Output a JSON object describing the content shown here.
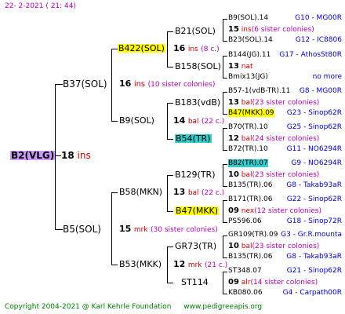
{
  "header": {
    "date": "22-  2-2021",
    "time": "( 21:  44)"
  },
  "footer": {
    "copyright": "Copyright 2004-2021 @ Karl Kehrle Foundation",
    "site": "www.pedigreeapis.org"
  },
  "root": {
    "name": "B2(VLG)",
    "num": "18",
    "note": "ins"
  },
  "gen1": [
    {
      "name": "B37(SOL)",
      "num": "16",
      "note": "ins",
      "sisters": "(10 sister colonies)"
    },
    {
      "name": "B5(SOL)",
      "num": "15",
      "note": "mrk",
      "sisters": "(30 sister colonies)"
    }
  ],
  "gen2": [
    {
      "name": "B422(SOL)",
      "num": "16",
      "note": "ins",
      "sisters": "(8 c.)"
    },
    {
      "name": "B9(SOL)",
      "num": "14",
      "note": "bal",
      "sisters": "(22 c.)"
    },
    {
      "name": "B58(MKN)",
      "num": "13",
      "note": "bal",
      "sisters": "(22 c.)"
    },
    {
      "name": "B53(MKK)",
      "num": "12",
      "note": "mrk",
      "sisters": "(21 c.)"
    }
  ],
  "gen3": [
    {
      "name": "B21(SOL)"
    },
    {
      "name": "B158(SOL)"
    },
    {
      "name": "B183(vdB)"
    },
    {
      "name": "B54(TR)"
    },
    {
      "name": "B129(TR)"
    },
    {
      "name": "B47(MKK)"
    },
    {
      "name": "GR73(TR)"
    },
    {
      "name": "ST114"
    }
  ],
  "gen4": [
    {
      "name": "B9(SOL).14",
      "id": "G10 - MG00R"
    },
    {
      "num": "15",
      "note": "ins",
      "sisters": "(6 sister colonies)"
    },
    {
      "name": "B23(SOL).14",
      "id": "G12 - IC8806"
    },
    {
      "name": "B144(JG).11",
      "id": "G17 - AthosSt80R"
    },
    {
      "num": "13",
      "note": "nat",
      "sisters": ""
    },
    {
      "name": "Bmix13(JG)",
      "id": "no more"
    },
    {
      "name": "B57-1(vdB-TR).11",
      "id": "G8 - MG00R"
    },
    {
      "num": "13",
      "note": "bal",
      "sisters": "(23 sister colonies)"
    },
    {
      "name": "B47(MKK).09",
      "id": "G23 - Sinop62R"
    },
    {
      "name": "B70(TR).10",
      "id": "G25 - Sinop62R"
    },
    {
      "num": "12",
      "note": "bal",
      "sisters": "(24 sister colonies)"
    },
    {
      "name": "B72(TR).10",
      "id": "G11 - NO6294R"
    },
    {
      "name": "B82(TR).07",
      "id": "G9 - NO6294R"
    },
    {
      "num": "10",
      "note": "bal",
      "sisters": "(23 sister colonies)"
    },
    {
      "name": "B135(TR).06",
      "id": "G8 - Takab93aR"
    },
    {
      "name": "B171(TR).06",
      "id": "G22 - Sinop62R"
    },
    {
      "num": "09",
      "note": "nex",
      "sisters": "(12 sister colonies)"
    },
    {
      "name": "PS596.06",
      "id": "G18 - Sinop72R"
    },
    {
      "name": "GR109(TR).09",
      "id": "G3 - Gr.R.mounta"
    },
    {
      "num": "10",
      "note": "bal",
      "sisters": "(23 sister colonies)"
    },
    {
      "name": "B135(TR).06",
      "id": "G8 - Takab93aR"
    },
    {
      "name": "ST348.07",
      "id": "G21 - Sinop62R"
    },
    {
      "num": "09",
      "note": "alr",
      "sisters": "(14 sister colonies)"
    },
    {
      "name": "KB080.06",
      "id": "G4 - Carpath00R"
    }
  ]
}
